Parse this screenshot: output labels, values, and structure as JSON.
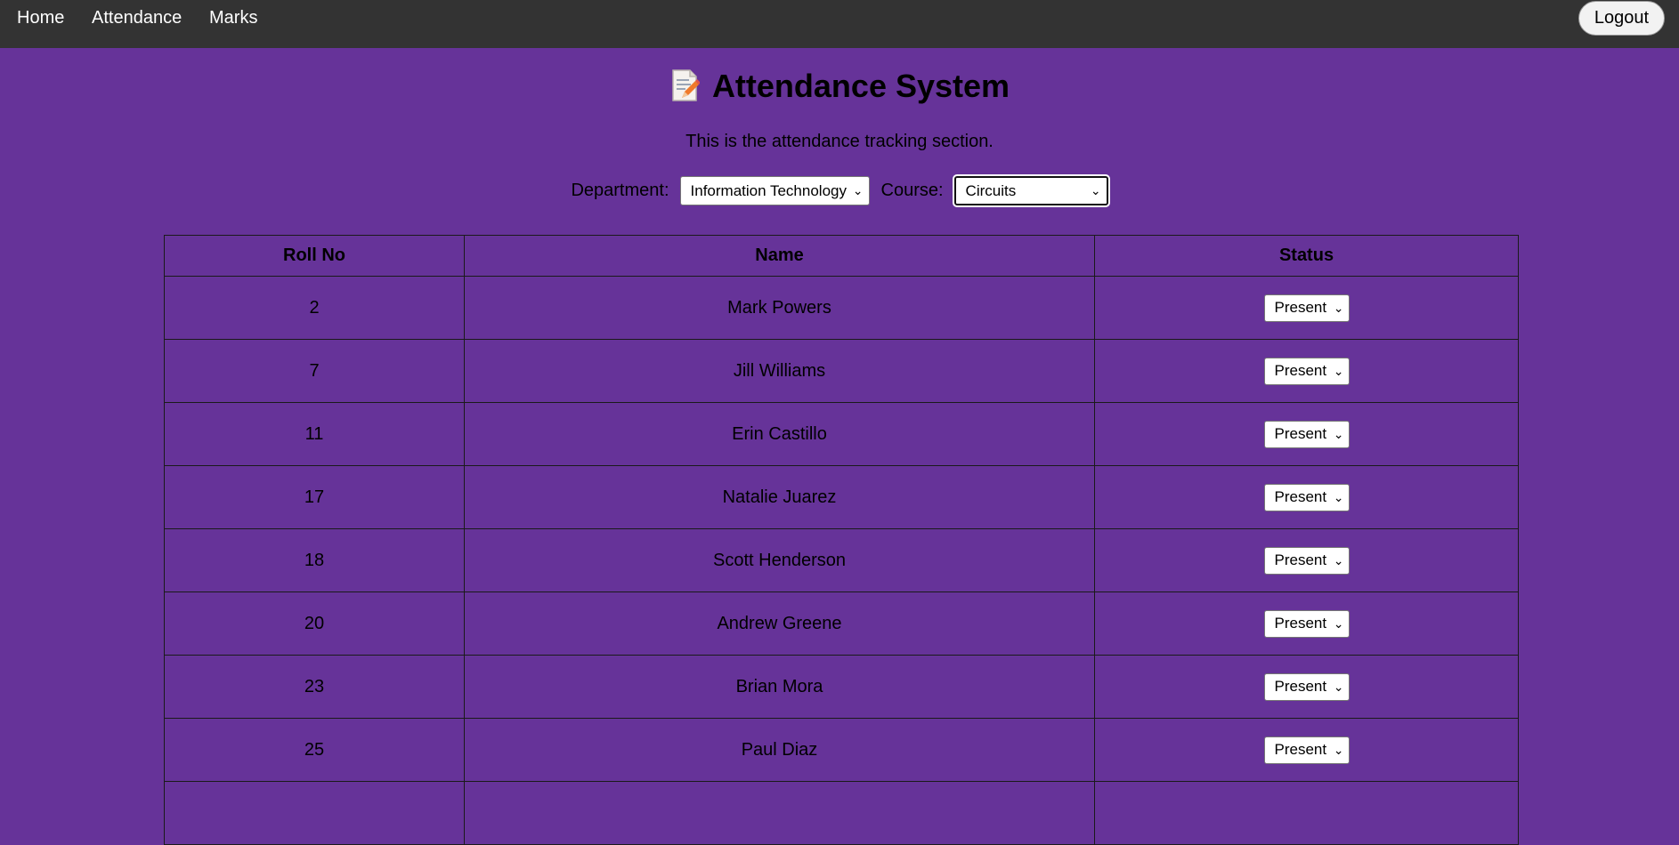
{
  "nav": {
    "items": [
      "Home",
      "Attendance",
      "Marks"
    ],
    "logout_label": "Logout"
  },
  "header": {
    "icon": "memo-icon",
    "title": "Attendance System",
    "subtitle": "This is the attendance tracking section."
  },
  "filters": {
    "department_label": "Department:",
    "department_value": "Information Technology",
    "course_label": "Course:",
    "course_value": "Circuits"
  },
  "table": {
    "headers": [
      "Roll No",
      "Name",
      "Status"
    ],
    "rows": [
      {
        "roll": "2",
        "name": "Mark Powers",
        "status": "Present"
      },
      {
        "roll": "7",
        "name": "Jill Williams",
        "status": "Present"
      },
      {
        "roll": "11",
        "name": "Erin Castillo",
        "status": "Present"
      },
      {
        "roll": "17",
        "name": "Natalie Juarez",
        "status": "Present"
      },
      {
        "roll": "18",
        "name": "Scott Henderson",
        "status": "Present"
      },
      {
        "roll": "20",
        "name": "Andrew Greene",
        "status": "Present"
      },
      {
        "roll": "23",
        "name": "Brian Mora",
        "status": "Present"
      },
      {
        "roll": "25",
        "name": "Paul Diaz",
        "status": "Present"
      }
    ]
  },
  "colors": {
    "background": "#663399",
    "navbar": "#333333"
  }
}
